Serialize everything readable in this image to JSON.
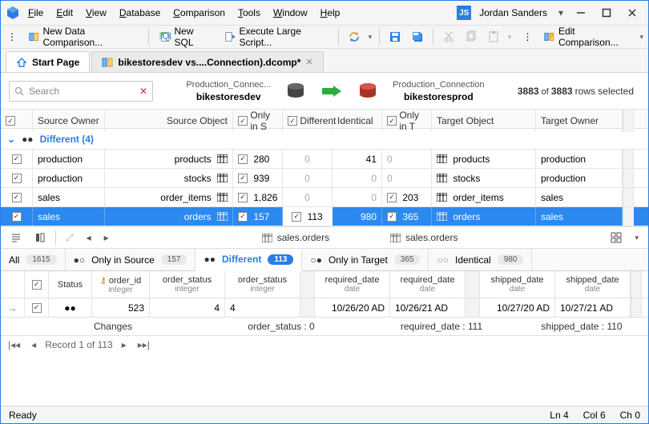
{
  "menu": [
    "File",
    "Edit",
    "View",
    "Database",
    "Comparison",
    "Tools",
    "Window",
    "Help"
  ],
  "user": {
    "initials": "JS",
    "name": "Jordan Sanders"
  },
  "toolbar": {
    "newDataComparison": "New Data Comparison...",
    "newSql": "New SQL",
    "executeLargeScript": "Execute Large Script...",
    "editComparison": "Edit Comparison..."
  },
  "tabs": {
    "start": "Start Page",
    "doc": "bikestoresdev vs....Connection).dcomp*"
  },
  "search": {
    "placeholder": "Search"
  },
  "source": {
    "conn": "Production_Connec...",
    "db": "bikestoresdev"
  },
  "target": {
    "conn": "Production_Connection",
    "db": "bikestoresprod"
  },
  "selInfo": {
    "a": "3883",
    "b": "3883",
    "suffix": "rows selected"
  },
  "cols": [
    "Source Owner",
    "Source Object",
    "Only in S",
    "Different",
    "Identical",
    "Only in T",
    "Target Object",
    "Target Owner"
  ],
  "group": "Different (4)",
  "rows": [
    {
      "owner": "production",
      "obj": "products",
      "onlyS": "280",
      "diff": "0",
      "ident": "41",
      "onlyT": "0",
      "tobj": "products",
      "towner": "production",
      "sel": false
    },
    {
      "owner": "production",
      "obj": "stocks",
      "onlyS": "939",
      "diff": "0",
      "ident": "0",
      "onlyT": "0",
      "tobj": "stocks",
      "towner": "production",
      "sel": false
    },
    {
      "owner": "sales",
      "obj": "order_items",
      "onlyS": "1,826",
      "diff": "0",
      "ident": "0",
      "onlyT": "203",
      "tobj": "order_items",
      "towner": "sales",
      "sel": false
    },
    {
      "owner": "sales",
      "obj": "orders",
      "onlyS": "157",
      "diff": "113",
      "ident": "980",
      "onlyT": "365",
      "tobj": "orders",
      "towner": "sales",
      "sel": true
    }
  ],
  "midbar": {
    "srcTable": "sales.orders",
    "tgtTable": "sales.orders"
  },
  "filters": {
    "all": {
      "label": "All",
      "count": "1615"
    },
    "onlySource": {
      "label": "Only in Source",
      "count": "157"
    },
    "different": {
      "label": "Different",
      "count": "113"
    },
    "onlyTarget": {
      "label": "Only in Target",
      "count": "365"
    },
    "identical": {
      "label": "Identical",
      "count": "980"
    }
  },
  "detailCols": {
    "status": "Status",
    "order_id": "order_id",
    "order_id_t": "integer",
    "order_status": "order_status",
    "order_status_t": "integer",
    "required_date": "required_date",
    "required_date_t": "date",
    "shipped_date": "shipped_date",
    "shipped_date_t": "date"
  },
  "detailRow": {
    "order_id": "523",
    "order_status_s": "4",
    "order_status_t": "4",
    "required_date_s": "10/26/20 AD",
    "required_date_t": "10/26/21 AD",
    "shipped_date_s": "10/27/20 AD",
    "shipped_date_t": "10/27/21 AD"
  },
  "changes": {
    "label": "Changes",
    "order_status": "order_status : 0",
    "required_date": "required_date : 111",
    "shipped_date": "shipped_date : 110"
  },
  "record": "Record 1 of 113",
  "status": {
    "ready": "Ready",
    "ln": "Ln 4",
    "col": "Col 6",
    "ch": "Ch 0"
  }
}
